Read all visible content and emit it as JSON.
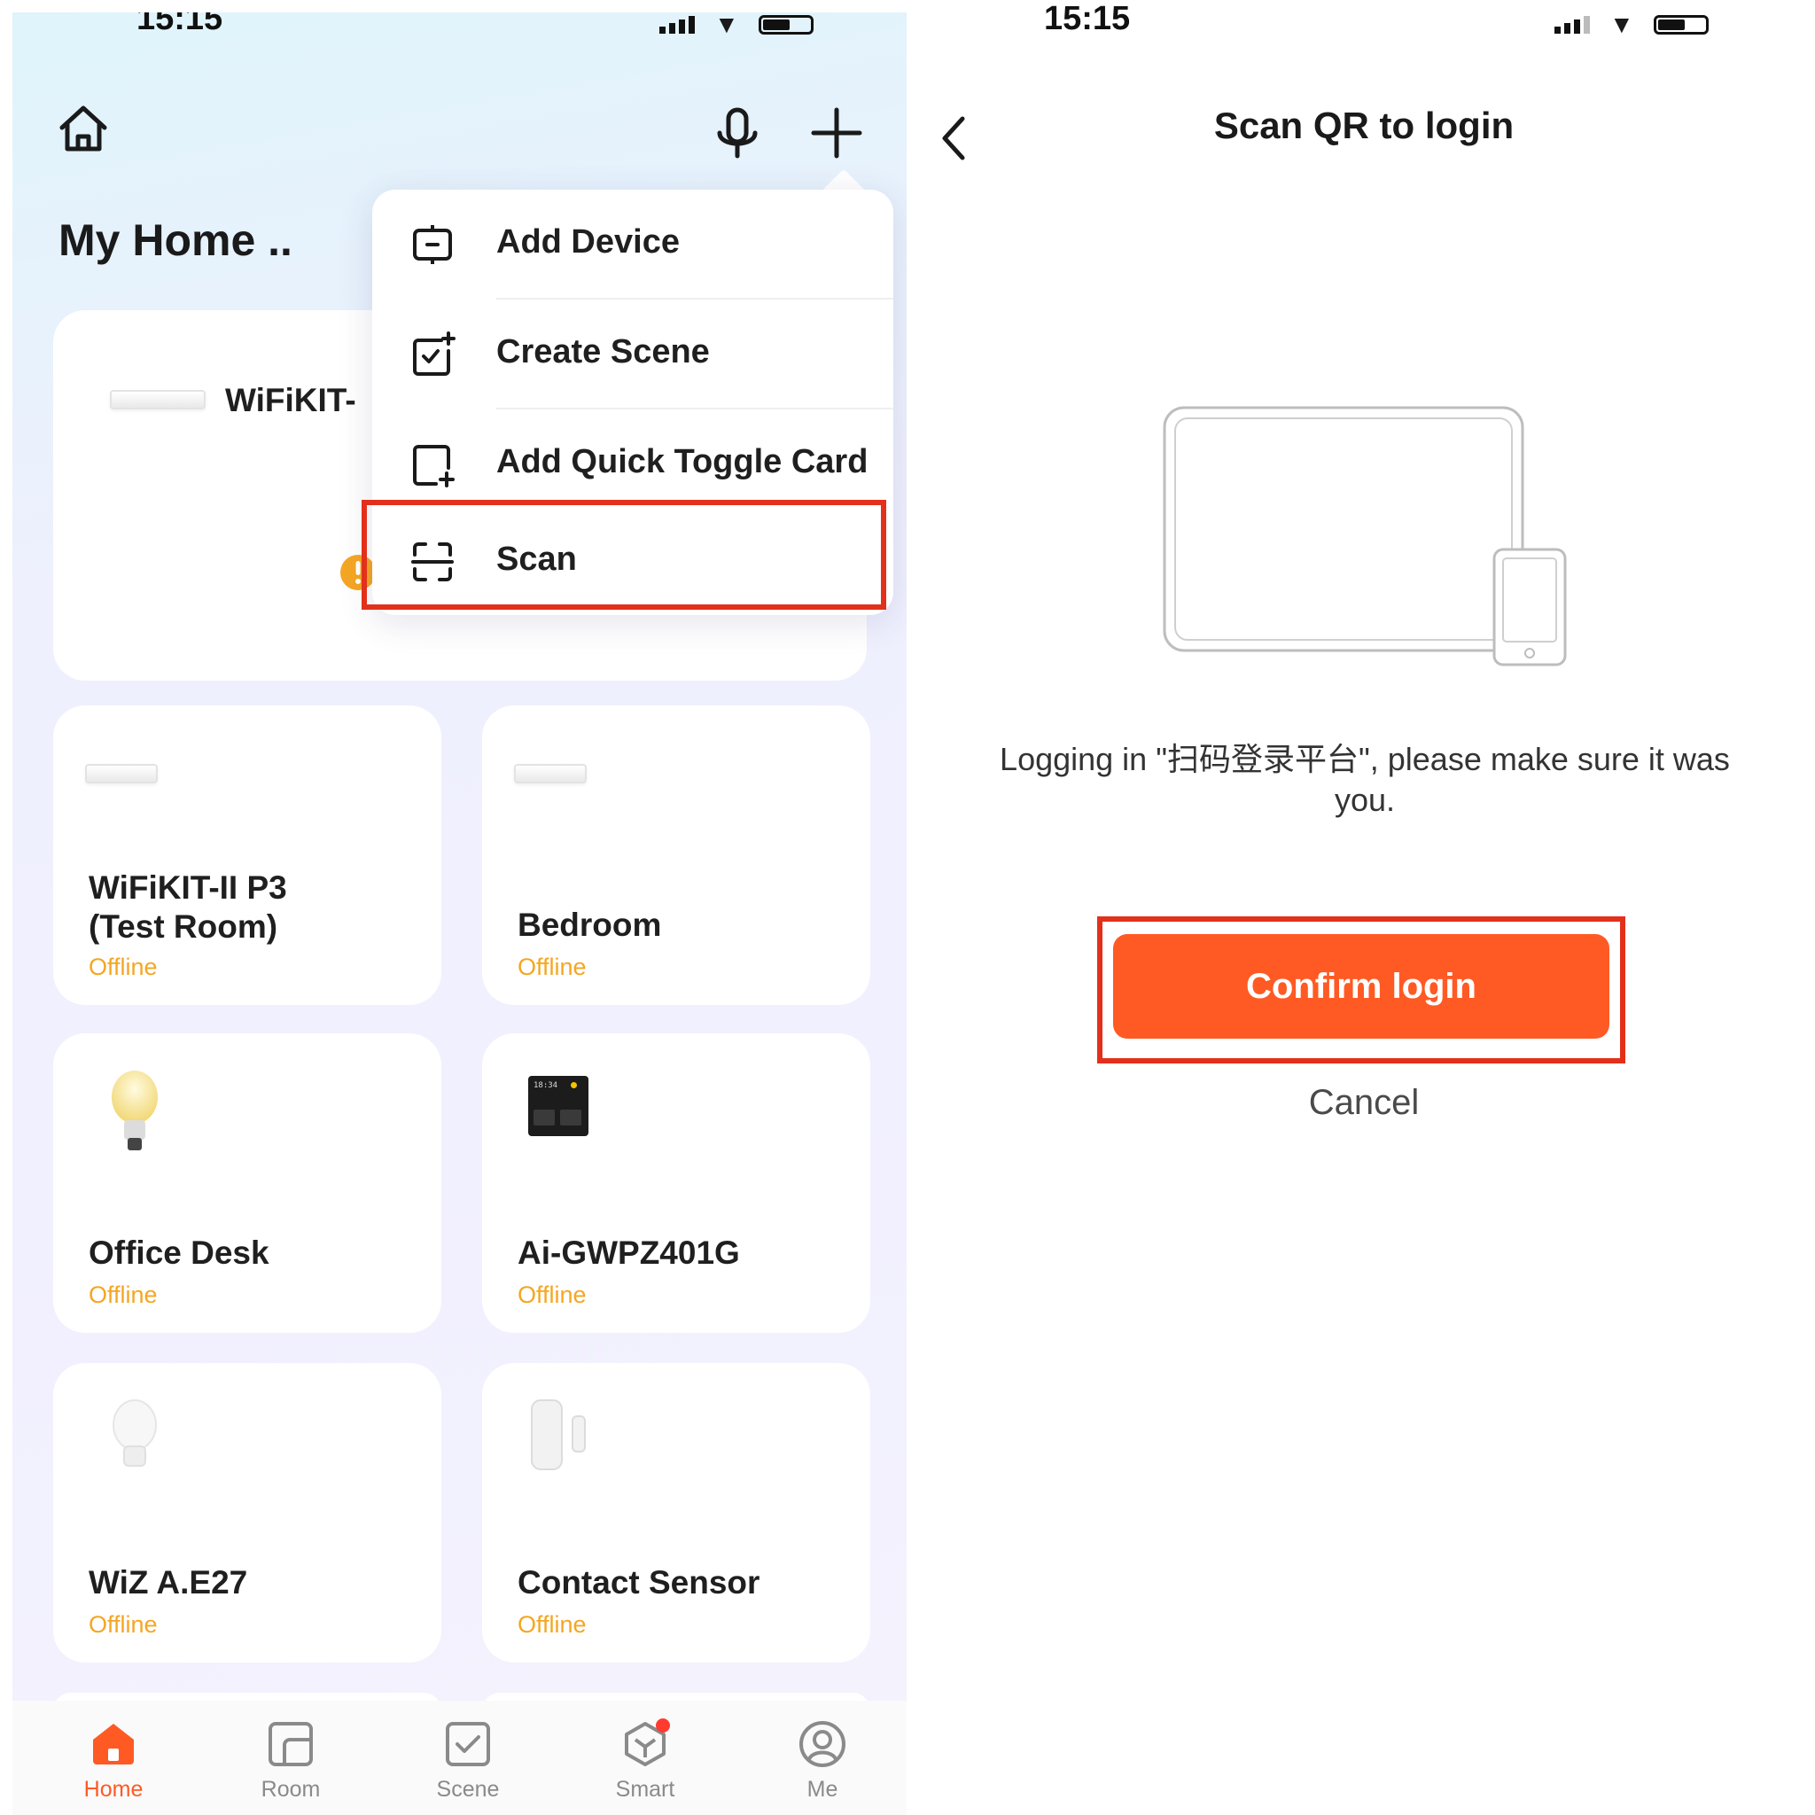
{
  "left": {
    "status_time": "15:15",
    "title": "My Home ..",
    "featured_card": {
      "name": "WiFiKIT-"
    },
    "menu": {
      "items": [
        {
          "label": "Add Device",
          "icon": "add-device-icon"
        },
        {
          "label": "Create Scene",
          "icon": "create-scene-icon"
        },
        {
          "label": "Add Quick Toggle Card",
          "icon": "quick-toggle-icon"
        },
        {
          "label": "Scan",
          "icon": "scan-icon"
        }
      ]
    },
    "devices": [
      {
        "name": "WiFiKIT-II P3\n(Test Room)",
        "status": "Offline",
        "image": "ac-unit"
      },
      {
        "name": "Bedroom",
        "status": "Offline",
        "image": "ac-unit"
      },
      {
        "name": "Office Desk",
        "status": "Offline",
        "image": "bulb-color"
      },
      {
        "name": "Ai-GWPZ401G",
        "status": "Offline",
        "image": "panel"
      },
      {
        "name": "WiZ A.E27",
        "status": "Offline",
        "image": "bulb-white"
      },
      {
        "name": "Contact Sensor",
        "status": "Offline",
        "image": "contact-sensor"
      }
    ],
    "tabs": [
      {
        "label": "Home",
        "active": true
      },
      {
        "label": "Room",
        "active": false
      },
      {
        "label": "Scene",
        "active": false
      },
      {
        "label": "Smart",
        "active": false
      },
      {
        "label": "Me",
        "active": false
      }
    ],
    "panel_time": "18:34"
  },
  "right": {
    "status_time": "15:15",
    "title": "Scan QR to login",
    "message": "Logging in \"扫码登录平台\", please make sure it was you.",
    "confirm_label": "Confirm login",
    "cancel_label": "Cancel"
  },
  "colors": {
    "accent": "#ff5a24",
    "offline": "#f5a623",
    "highlight": "#e3301b",
    "warning": "#f5a623"
  }
}
